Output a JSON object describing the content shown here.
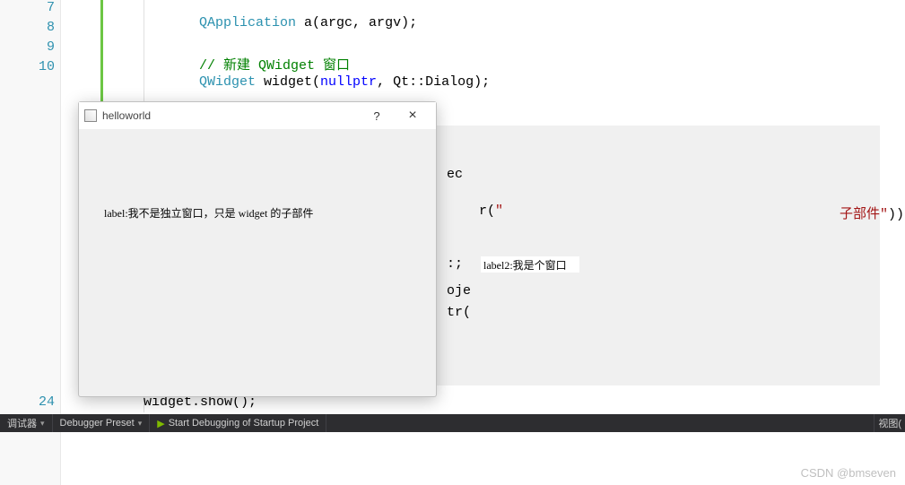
{
  "gutter": {
    "lines": [
      "7",
      "8",
      "9",
      "10",
      "",
      "",
      "",
      "",
      "",
      "",
      "",
      "",
      "",
      "",
      "",
      "",
      "",
      "24"
    ]
  },
  "code": {
    "l7_type": "QApplication",
    "l7_rest": " a(argc, argv);",
    "l9_comment": "// 新建 QWidget 窗口",
    "l10_type": "QWidget",
    "l10_rest": " widget(",
    "l10_null": "nullptr",
    "l10_rest2": ", Qt::Dialog);",
    "frag_ec": "ec",
    "frag_r": "r(",
    "frag_str_end": "子部件\"",
    "frag_paren": "));",
    "frag_colon": ":;",
    "frag_oje": "oje",
    "frag_tr": "tr(",
    "l24": "widget.show();"
  },
  "qt_window": {
    "title": "helloworld",
    "help": "?",
    "close": "×",
    "label1": "label:我不是独立窗口，只是 widget 的子部件"
  },
  "label2": "label2:我是个窗口",
  "statusbar": {
    "debugger": "调试器",
    "preset": "Debugger Preset",
    "start": "Start Debugging of Startup Project",
    "view": "视图("
  },
  "watermark": "CSDN @bmseven"
}
